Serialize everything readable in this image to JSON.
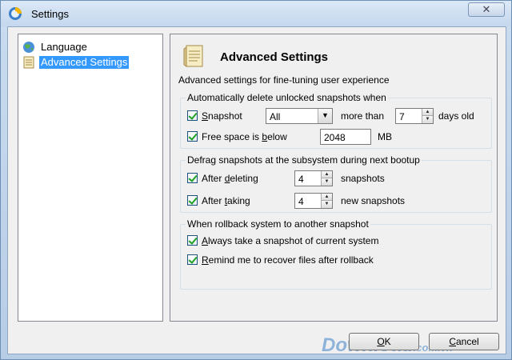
{
  "window": {
    "title": "Settings",
    "close_glyph": "✕"
  },
  "nav": {
    "items": [
      {
        "label": "Language",
        "icon": "globe-icon",
        "selected": false
      },
      {
        "label": "Advanced Settings",
        "icon": "page-icon",
        "selected": true
      }
    ]
  },
  "page": {
    "title": "Advanced Settings",
    "description": "Advanced settings for fine-tuning user experience"
  },
  "group1": {
    "legend": "Automatically delete unlocked snapshots when",
    "snapshot_label_u": "S",
    "snapshot_label_rest": "napshot",
    "snapshot_checked": true,
    "combo_value": "All",
    "more_than": "more than",
    "days_value": "7",
    "days_old": "days old",
    "free_space_pre": "Free space is ",
    "free_space_u": "b",
    "free_space_post": "elow",
    "free_space_checked": true,
    "free_space_value": "2048",
    "unit": "MB"
  },
  "group2": {
    "legend": "Defrag snapshots at the subsystem during next bootup",
    "after_deleting_pre": "After ",
    "after_deleting_u": "d",
    "after_deleting_post": "eleting",
    "after_deleting_checked": true,
    "after_deleting_value": "4",
    "snapshots": "snapshots",
    "after_taking_pre": "After ",
    "after_taking_u": "t",
    "after_taking_post": "aking",
    "after_taking_checked": true,
    "after_taking_value": "4",
    "new_snapshots": "new snapshots"
  },
  "group3": {
    "legend": "When rollback system to another snapshot",
    "always_u": "A",
    "always_rest": "lways take a snapshot of current system",
    "always_checked": true,
    "remind_u": "R",
    "remind_rest": "emind me to recover files after rollback",
    "remind_checked": true
  },
  "buttons": {
    "ok_u": "O",
    "ok_rest": "K",
    "cancel_u": "C",
    "cancel_rest": "ancel"
  },
  "watermark": {
    "main": "Download",
    "suffix": ".com.vn"
  },
  "colors": {
    "selection": "#3399ff",
    "accent": "#1c5180"
  }
}
